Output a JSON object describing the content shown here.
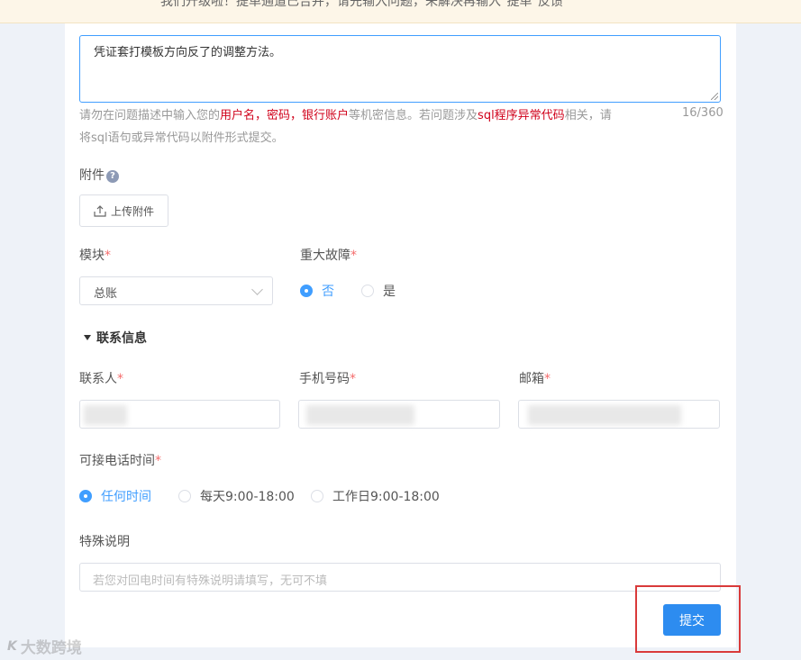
{
  "banner": {
    "text": "我们升级啦！提单通道已合并，请先输入问题，未解决再输入\"提单\"反馈"
  },
  "description": {
    "value": "凭证套打模板方向反了的调整方法。",
    "hint_part1": "请勿在问题描述中输入您的",
    "hint_red1": "用户名，密码，银行账户",
    "hint_part2": "等机密信息。若问题涉及",
    "hint_red2": "sql程序异常代码",
    "hint_part3": "相关，请将sql语句或异常代码以附件形式提交。",
    "counter": "16/360"
  },
  "attachment": {
    "label": "附件",
    "help": "?",
    "upload_label": "上传附件"
  },
  "module": {
    "label": "模块",
    "required": "*",
    "value": "总账"
  },
  "major_fault": {
    "label": "重大故障",
    "required": "*",
    "options": [
      "否",
      "是"
    ],
    "selected": "否"
  },
  "contact_section": {
    "title": "联系信息"
  },
  "contact": {
    "person_label": "联系人",
    "phone_label": "手机号码",
    "email_label": "邮箱",
    "required": "*"
  },
  "call_time": {
    "label": "可接电话时间",
    "required": "*",
    "options": [
      "任何时间",
      "每天9:00-18:00",
      "工作日9:00-18:00"
    ],
    "selected": "任何时间"
  },
  "special": {
    "label": "特殊说明",
    "placeholder": "若您对回电时间有特殊说明请填写，无可不填"
  },
  "submit": {
    "label": "提交"
  },
  "watermark": {
    "logo": "K",
    "text": "大数跨境"
  },
  "colors": {
    "accent": "#409eff",
    "button": "#2d8cf0",
    "required": "#f56c6c",
    "sensitive": "#d0021b",
    "highlight": "#d93a3a"
  }
}
